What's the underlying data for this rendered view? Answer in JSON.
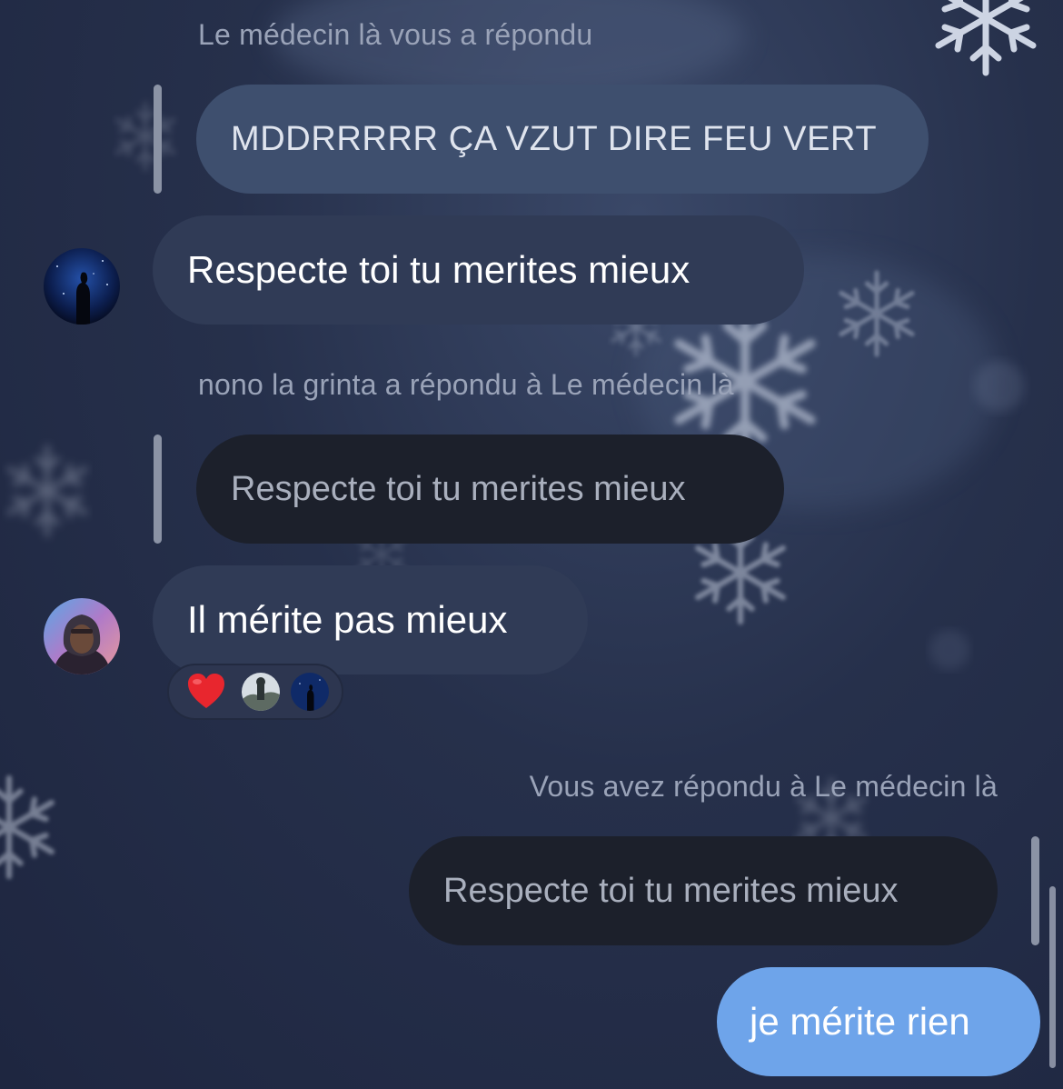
{
  "thread": {
    "block1": {
      "reply_caption": "Le médecin là vous a répondu",
      "quoted_text": "MDDRRRRR ÇA VZUT DIRE FEU VERT",
      "message": "Respecte toi tu merites mieux"
    },
    "block2": {
      "reply_caption": "nono la grinta a répondu à Le médecin là",
      "quoted_text": "Respecte toi tu merites mieux",
      "message": "Il mérite pas mieux",
      "reaction_emoji": "❤️"
    },
    "block3": {
      "reply_caption": "Vous avez répondu à Le médecin là",
      "quoted_text": "Respecte toi tu merites mieux",
      "message": "je mérite rien"
    }
  },
  "icons": {
    "reaction": "heart-icon",
    "sender_avatar": "avatar-night-silhouette",
    "friend_avatar": "avatar-hooded-person"
  },
  "colors": {
    "background": "#26304b",
    "incoming_bubble": "#303b56",
    "quoted_light": "#3e4f6e",
    "quoted_dark": "#1c202b",
    "outgoing_bubble": "#6ea4ea",
    "caption_text": "#9aa3b8"
  }
}
